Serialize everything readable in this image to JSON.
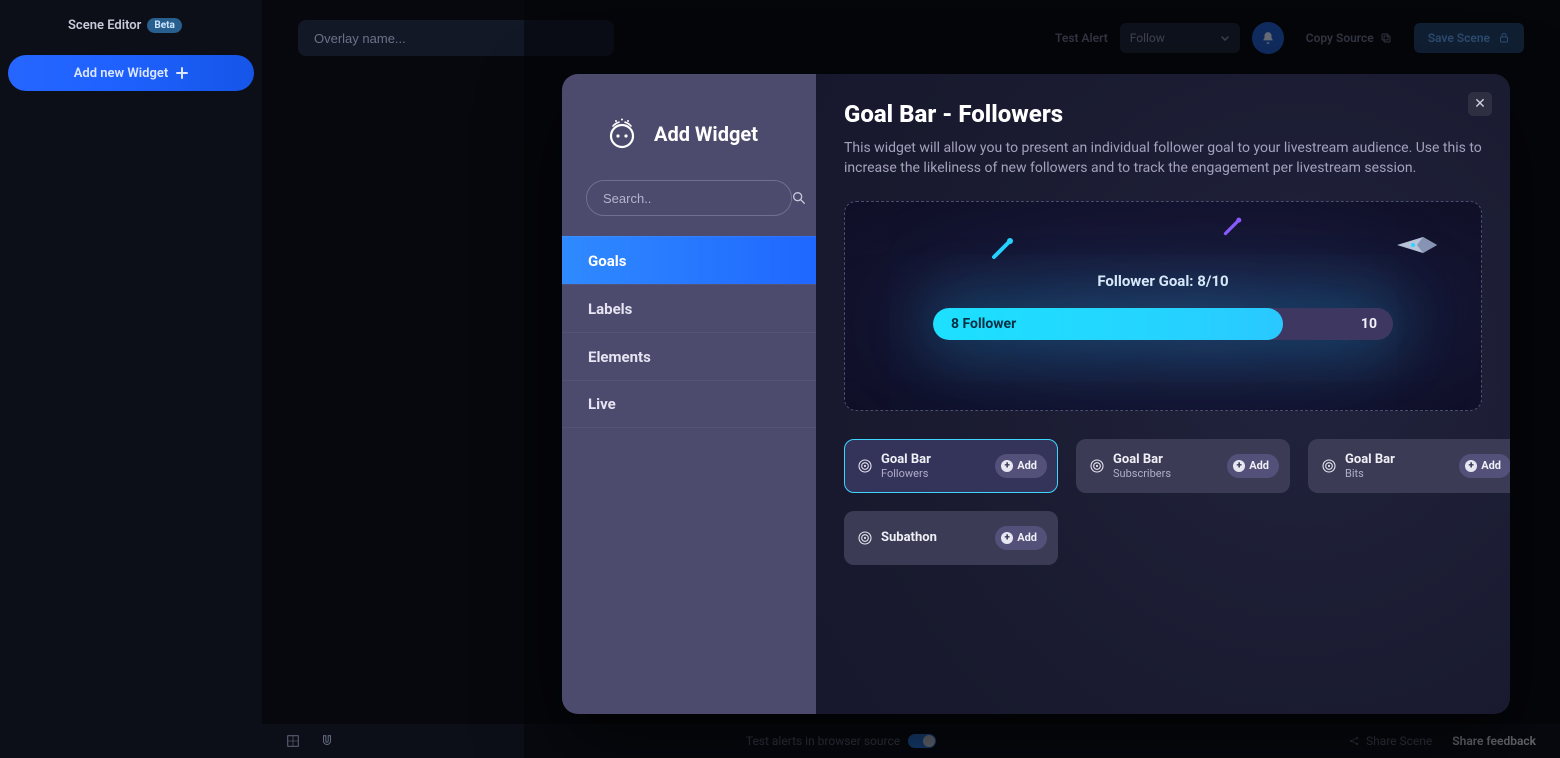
{
  "leftPane": {
    "title": "Scene Editor",
    "badge": "Beta",
    "addWidget": "Add new Widget"
  },
  "topbar": {
    "overlayPlaceholder": "Overlay name...",
    "testAlert": "Test Alert",
    "followLabel": "Follow",
    "copySource": "Copy Source",
    "saveScene": "Save Scene"
  },
  "bottombar": {
    "testLabel": "Test alerts in browser source",
    "shareScene": "Share Scene",
    "feedback": "Share feedback"
  },
  "modal": {
    "logoText": "Add Widget",
    "searchPlaceholder": "Search..",
    "menu": [
      {
        "label": "Goals",
        "active": true
      },
      {
        "label": "Labels",
        "active": false
      },
      {
        "label": "Elements",
        "active": false
      },
      {
        "label": "Live",
        "active": false
      }
    ],
    "title": "Goal Bar - Followers",
    "description": "This widget will allow you to present an individual follower goal to your livestream audience. Use this to increase the likeliness of new followers and to track the engagement per livestream session.",
    "preview": {
      "label": "Follower Goal: 8/10",
      "fillText": "8 Follower",
      "total": "10"
    },
    "cards": [
      {
        "title": "Goal Bar",
        "sub": "Followers",
        "add": "Add",
        "active": true
      },
      {
        "title": "Goal Bar",
        "sub": "Subscribers",
        "add": "Add",
        "active": false
      },
      {
        "title": "Goal Bar",
        "sub": "Bits",
        "add": "Add",
        "active": false
      },
      {
        "title": "Subathon",
        "sub": "",
        "add": "Add",
        "active": false
      }
    ]
  }
}
